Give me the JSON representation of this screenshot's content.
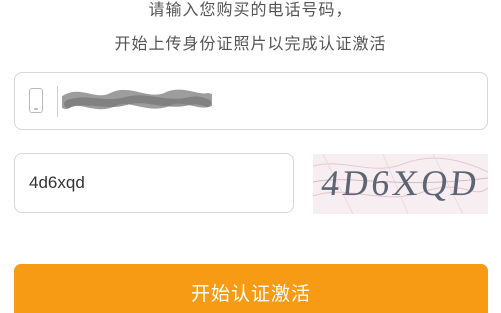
{
  "instructions": {
    "line1": "请输入您购买的电话号码，",
    "line2": "开始上传身份证照片以完成认证激活"
  },
  "phone": {
    "icon": "phone-icon",
    "value": ""
  },
  "captcha": {
    "input_value": "4d6xqd",
    "image_text": "4D6XQD"
  },
  "submit": {
    "label": "开始认证激活"
  },
  "colors": {
    "accent": "#f79a14",
    "border": "#d6d6d6",
    "text": "#555555"
  }
}
